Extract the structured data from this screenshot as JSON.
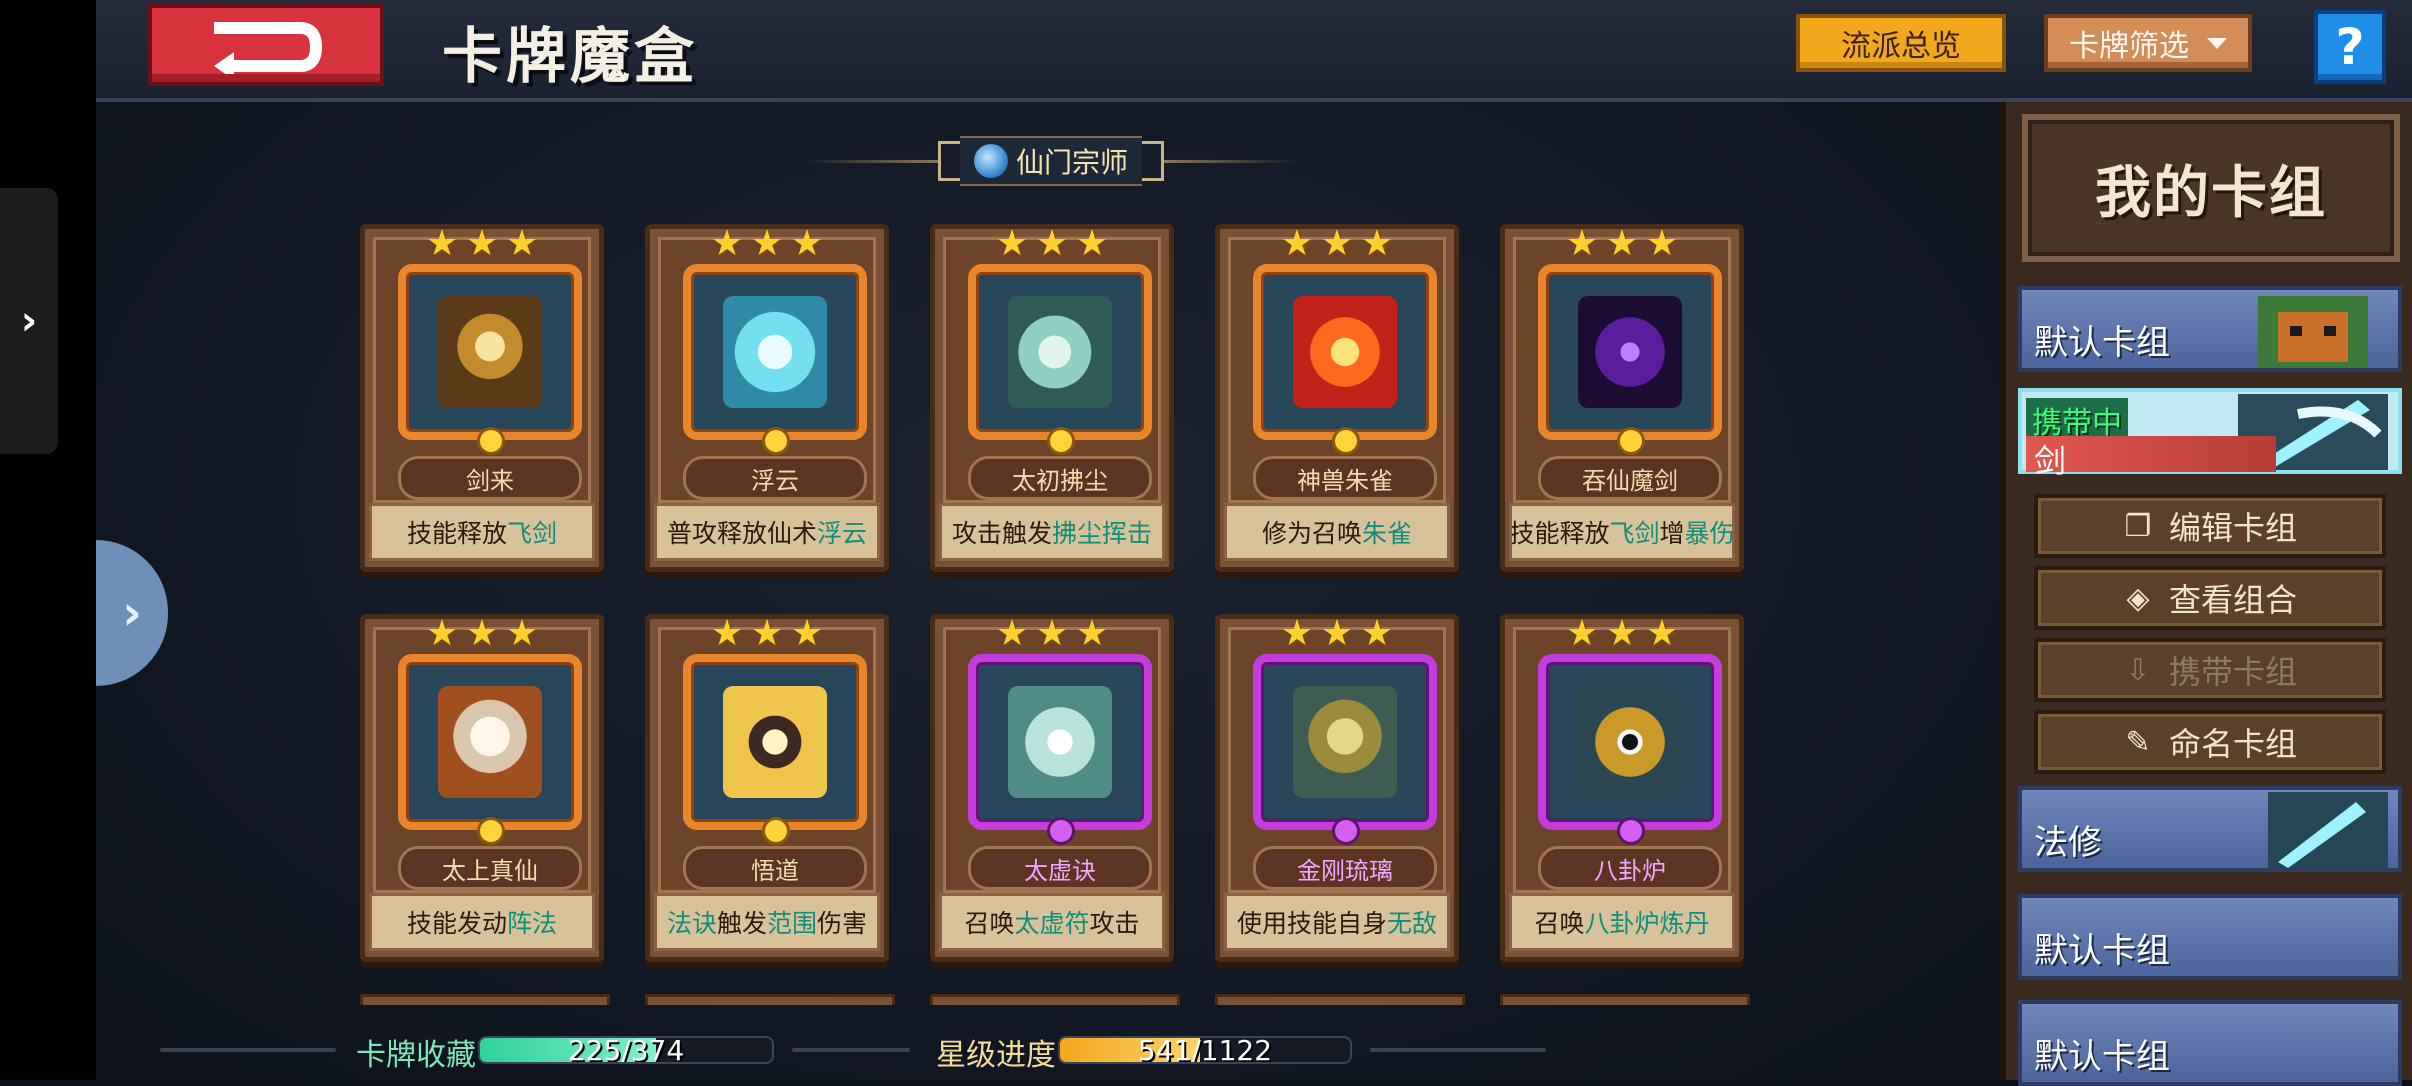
{
  "header": {
    "title": "卡牌魔盒",
    "overview_button": "流派总览",
    "filter_button": "卡牌筛选",
    "help_label": "?"
  },
  "section": {
    "title": "仙门宗师"
  },
  "cards": [
    {
      "name": "剑来",
      "stars": 3,
      "rarity": "gold",
      "desc_pre": "技能释放",
      "desc_hl": "飞剑",
      "desc_post": "",
      "art": "sword"
    },
    {
      "name": "浮云",
      "stars": 3,
      "rarity": "gold",
      "desc_pre": "普攻释放仙术",
      "desc_hl": "浮云",
      "desc_post": "",
      "art": "cloud"
    },
    {
      "name": "太初拂尘",
      "stars": 3,
      "rarity": "gold",
      "desc_pre": "攻击触发",
      "desc_hl": "拂尘挥击",
      "desc_post": "",
      "art": "whisk"
    },
    {
      "name": "神兽朱雀",
      "stars": 3,
      "rarity": "gold",
      "desc_pre": "修为召唤",
      "desc_hl": "朱雀",
      "desc_post": "",
      "art": "phoenix"
    },
    {
      "name": "吞仙魔剑",
      "stars": 3,
      "rarity": "gold",
      "desc_pre": "技能释放",
      "desc_hl": "飞剑",
      "desc_post": "增",
      "desc_hl2": "暴伤",
      "art": "demon-sword"
    },
    {
      "name": "太上真仙",
      "stars": 3,
      "rarity": "gold",
      "desc_pre": "技能发动",
      "desc_hl": "阵法",
      "desc_post": "",
      "art": "immortal"
    },
    {
      "name": "悟道",
      "stars": 3,
      "rarity": "gold",
      "desc_pre": "",
      "desc_hl": "法诀",
      "desc_post": "触发",
      "desc_hl2": "范围",
      "desc_post2": "伤害",
      "art": "meditate"
    },
    {
      "name": "太虚诀",
      "stars": 3,
      "rarity": "purple",
      "desc_pre": "召唤",
      "desc_hl": "太虚符",
      "desc_post": "攻击",
      "art": "talisman"
    },
    {
      "name": "金刚琉璃",
      "stars": 3,
      "rarity": "purple",
      "desc_pre": "使用技能自身",
      "desc_hl": "无敌",
      "desc_post": "",
      "art": "buddha"
    },
    {
      "name": "八卦炉",
      "stars": 3,
      "rarity": "purple",
      "desc_pre": "召唤",
      "desc_hl": "八卦炉炼丹",
      "desc_post": "",
      "art": "furnace"
    }
  ],
  "stats": {
    "collection_label": "卡牌收藏",
    "collection_text": "225/374",
    "collection_fraction": 0.6016,
    "star_label": "星级进度",
    "star_text": "541/1122",
    "star_fraction": 0.4822
  },
  "right_panel": {
    "title": "我的卡组",
    "decks": [
      {
        "label": "默认卡组"
      },
      {
        "tag": "携带中",
        "label": "剑"
      },
      {
        "label": "法修"
      },
      {
        "label": "默认卡组"
      },
      {
        "label": "默认卡组"
      }
    ],
    "actions": [
      {
        "label": "编辑卡组",
        "icon": "copy-icon",
        "enabled": true
      },
      {
        "label": "查看组合",
        "icon": "eye-icon",
        "enabled": true
      },
      {
        "label": "携带卡组",
        "icon": "download-icon",
        "enabled": false
      },
      {
        "label": "命名卡组",
        "icon": "pencil-icon",
        "enabled": true
      }
    ]
  },
  "colors": {
    "highlight_text": "#0f8f77",
    "collection_bar": "#2fd19a",
    "star_bar": "#f2a81c",
    "gold_frame": "#e8862c",
    "purple_frame": "#c53cdc"
  }
}
